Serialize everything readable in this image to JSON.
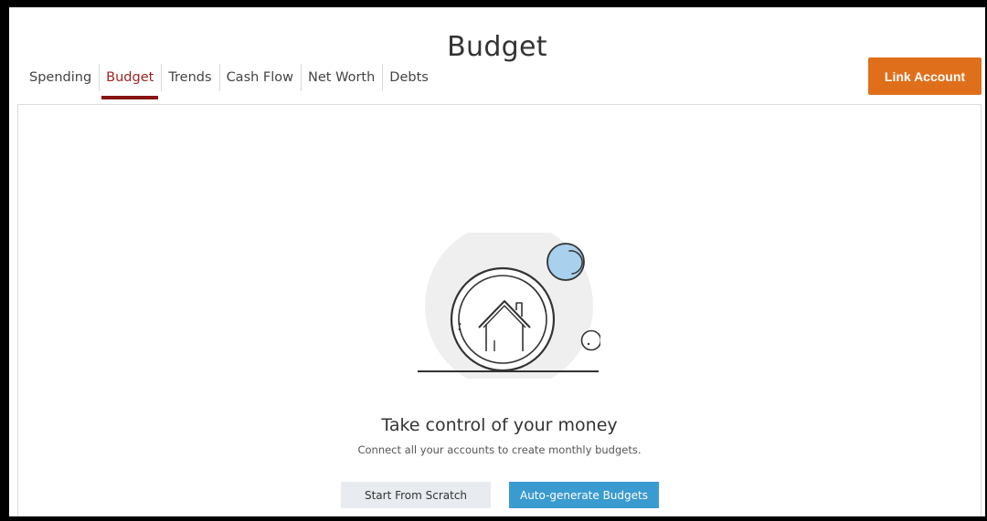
{
  "page": {
    "title": "Budget"
  },
  "tabs": [
    {
      "label": "Spending"
    },
    {
      "label": "Budget",
      "active": true
    },
    {
      "label": "Trends"
    },
    {
      "label": "Cash Flow"
    },
    {
      "label": "Net Worth"
    },
    {
      "label": "Debts"
    }
  ],
  "header": {
    "link_account_label": "Link Account"
  },
  "empty_state": {
    "illustration_icon": "house-coin-icon",
    "headline": "Take control of your money",
    "subtext": "Connect all your accounts to create monthly budgets.",
    "start_from_scratch_label": "Start From Scratch",
    "auto_generate_label": "Auto-generate Budgets"
  },
  "colors": {
    "accent_orange": "#e06f1b",
    "active_tab": "#8a1414",
    "primary_blue": "#3a9bd0",
    "bubble_blue": "#a9d0ec"
  }
}
